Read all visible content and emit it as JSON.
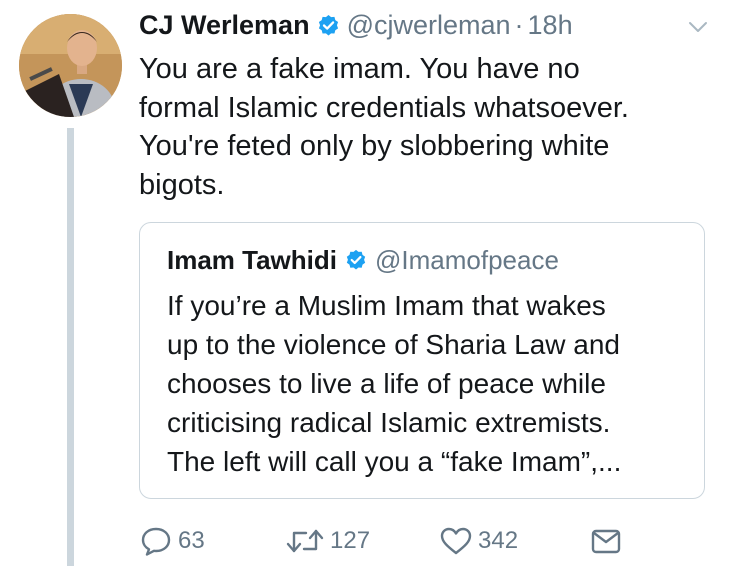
{
  "tweet": {
    "author_name": "CJ Werleman",
    "handle": "@cjwerleman",
    "separator": "·",
    "time": "18h",
    "text_lines": [
      "You are a fake imam. You have no",
      "formal Islamic credentials whatsoever.",
      "You're feted only by slobbering white",
      "bigots."
    ]
  },
  "quoted_tweet": {
    "author_name": "Imam Tawhidi",
    "handle": "@Imamofpeace",
    "text_lines": [
      "If you’re a Muslim Imam that wakes",
      "up to the violence of Sharia Law and",
      "chooses to live a life of peace while",
      "criticising radical Islamic extremists.",
      "The left will call you a “fake Imam”,..."
    ]
  },
  "actions": {
    "replies": "63",
    "retweets": "127",
    "likes": "342"
  },
  "colors": {
    "verified": "#1da1f2",
    "muted": "#657786",
    "border": "#ccd6dd",
    "thread_line": "#ccd6dd"
  },
  "icons": [
    "verified-badge-icon",
    "chevron-down-icon",
    "reply-icon",
    "retweet-icon",
    "like-icon",
    "direct-message-icon"
  ]
}
